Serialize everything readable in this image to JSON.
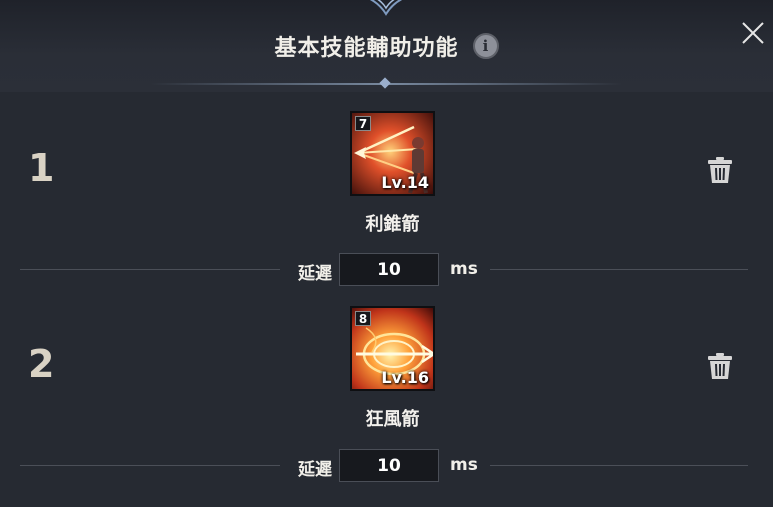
{
  "dialog": {
    "title": "基本技能輔助功能",
    "info_icon": "info-icon",
    "close_icon": "close-icon"
  },
  "rows": [
    {
      "index": "1",
      "skill": {
        "name": "利錐箭",
        "hotkey": "7",
        "level": "Lv.14"
      },
      "delay_label": "延遲",
      "delay_value": "10",
      "delay_unit": "ms",
      "delete_icon": "trash-icon"
    },
    {
      "index": "2",
      "skill": {
        "name": "狂風箭",
        "hotkey": "8",
        "level": "Lv.16"
      },
      "delay_label": "延遲",
      "delay_value": "10",
      "delay_unit": "ms",
      "delete_icon": "trash-icon"
    }
  ],
  "colors": {
    "background": "#24272f",
    "row_number": "#d9d2c4",
    "input_bg": "#17191e",
    "divider": "#4b4f58"
  }
}
